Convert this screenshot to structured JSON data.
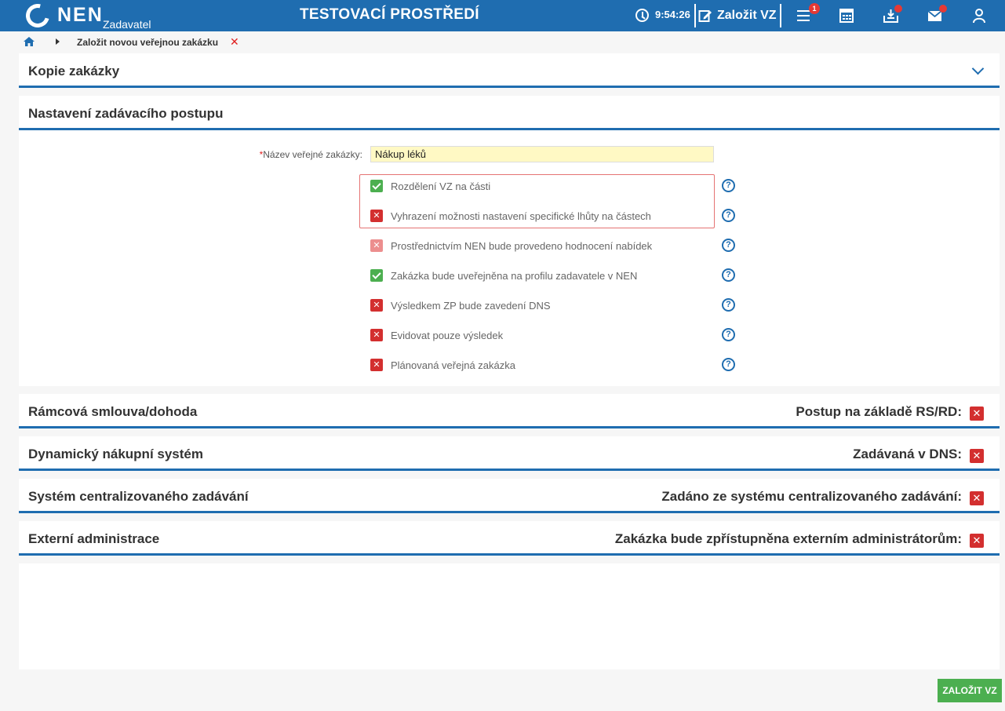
{
  "header": {
    "logo": "NEN",
    "logo_sub": "Zadavatel",
    "env_title": "TESTOVACÍ PROSTŘEDÍ",
    "time": "9:54:26",
    "create_label": "Založit VZ",
    "menu_badge": "1",
    "brand_color": "#1f6db0"
  },
  "breadcrumb": {
    "current": "Založit novou veřejnou zakázku"
  },
  "sections": {
    "copy": {
      "title": "Kopie zakázky"
    },
    "procedure": {
      "title": "Nastavení zadávacího postupu"
    },
    "framework": {
      "title": "Rámcová smlouva/dohoda",
      "right_label": "Postup na základě RS/RD:",
      "value": false
    },
    "dns": {
      "title": "Dynamický nákupní systém",
      "right_label": "Zadávaná v DNS:",
      "value": false
    },
    "central": {
      "title": "Systém centralizovaného zadávání",
      "right_label": "Zadáno ze systému centralizovaného zadávání:",
      "value": false
    },
    "external": {
      "title": "Externí administrace",
      "right_label": "Zakázka bude zpřístupněna externím administrátorům:",
      "value": false
    }
  },
  "form": {
    "name_label": "Název veřejné zakázky:",
    "required_mark": "*",
    "name_value": "Nákup léků",
    "options": [
      {
        "label": "Rozdělení VZ na části",
        "checked": true
      },
      {
        "label": "Vyhrazení možnosti nastavení specifické lhůty na částech",
        "checked": false
      },
      {
        "label": "Prostřednictvím NEN bude provedeno hodnocení nabídek",
        "checked": false,
        "disabled": true
      },
      {
        "label": "Zakázka bude uveřejněna na profilu zadavatele v NEN",
        "checked": true
      },
      {
        "label": "Výsledkem ZP bude zavedení DNS",
        "checked": false
      },
      {
        "label": "Evidovat pouze výsledek",
        "checked": false
      },
      {
        "label": "Plánovaná veřejná zakázka",
        "checked": false
      }
    ]
  },
  "actions": {
    "submit_label": "ZALOŽIT VZ"
  }
}
